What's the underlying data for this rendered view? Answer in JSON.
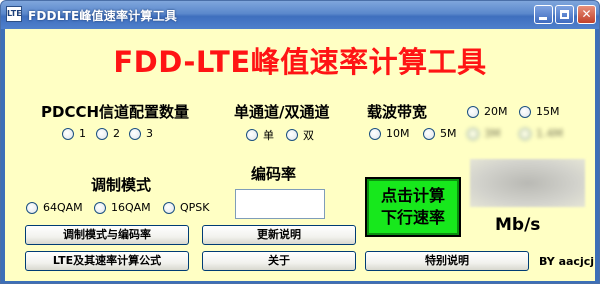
{
  "window": {
    "title": "FDDLTE峰值速率计算工具",
    "icon_text": "LTE",
    "minimize_icon": "minimize-icon",
    "maximize_icon": "maximize-icon",
    "close_icon": "close-icon",
    "close_glyph": "✕"
  },
  "heading": "FDD-LTE峰值速率计算工具",
  "pdcch": {
    "label": "PDCCH信道配置数量",
    "options": [
      "1",
      "2",
      "3"
    ]
  },
  "channel": {
    "label": "单通道/双通道",
    "options": [
      "单",
      "双"
    ]
  },
  "bandwidth": {
    "label": "载波带宽",
    "options": [
      "20M",
      "15M",
      "10M",
      "5M",
      "3M",
      "1.4M"
    ]
  },
  "modulation": {
    "label": "调制模式",
    "options": [
      "64QAM",
      "16QAM",
      "QPSK"
    ]
  },
  "code_rate": {
    "label": "编码率",
    "value": ""
  },
  "calculate_button": {
    "line1": "点击计算",
    "line2": "下行速率"
  },
  "result": {
    "value": "",
    "unit": "Mb/s"
  },
  "buttons": {
    "mod_and_coding": "调制模式与编码率",
    "lte_formula": "LTE及其速率计算公式",
    "update_notes": "更新说明",
    "about": "关于",
    "special_notes": "特别说明"
  },
  "author": "BY aacjcj",
  "colors": {
    "background": "#ffffc4",
    "heading": "#ff1414",
    "calc_button": "#17e81c"
  }
}
